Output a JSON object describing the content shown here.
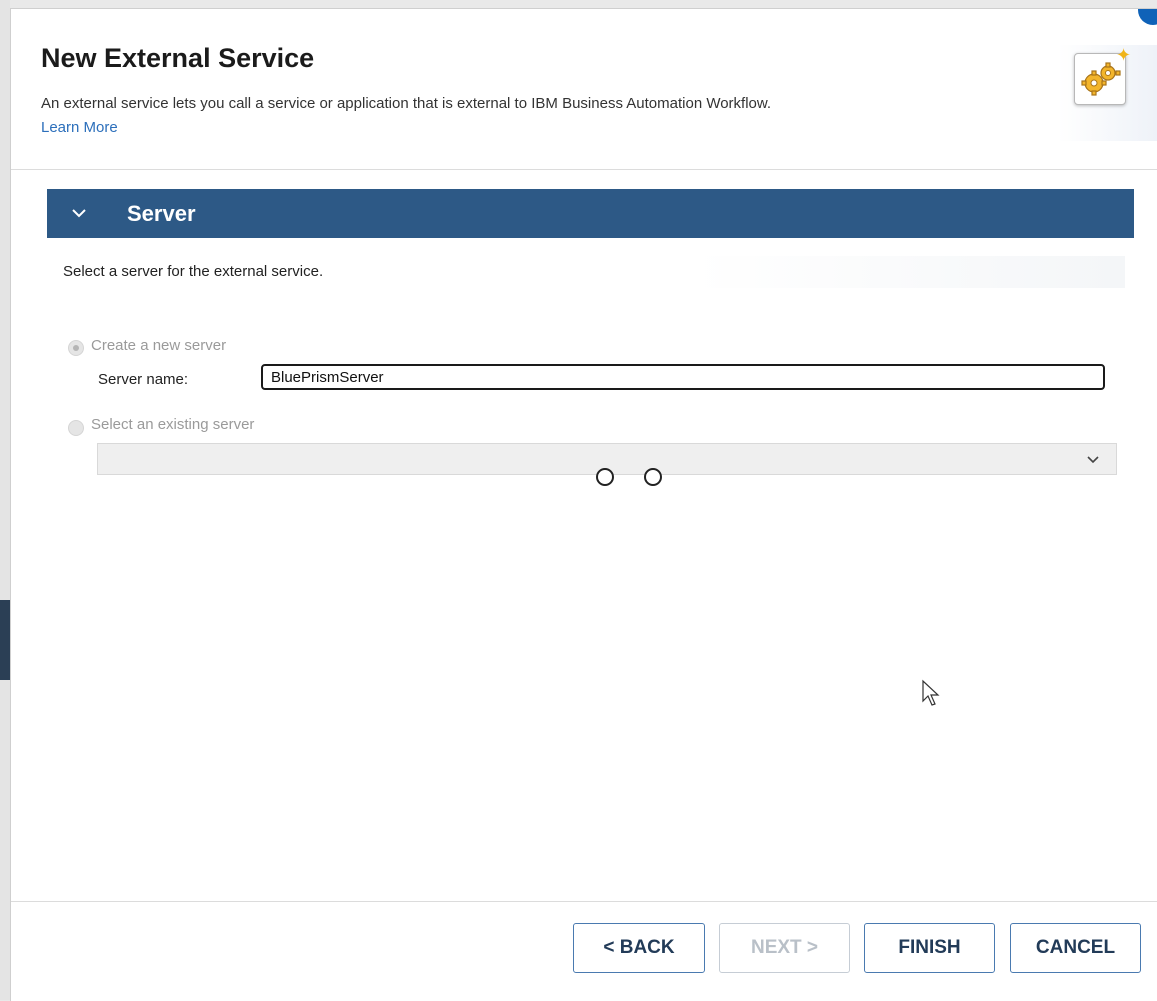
{
  "dialog": {
    "title": "New External Service",
    "description": "An external service lets you call a service or application that is external to IBM Business Automation Workflow.",
    "learn_more": "Learn More"
  },
  "section": {
    "title": "Server",
    "instruction": "Select a server for the external service."
  },
  "options": {
    "create_new_label": "Create a new server",
    "server_name_label": "Server name:",
    "server_name_value": "BluePrismServer",
    "select_existing_label": "Select an existing server",
    "existing_server_value": ""
  },
  "buttons": {
    "back": "< BACK",
    "next": "NEXT >",
    "finish": "FINISH",
    "cancel": "CANCEL"
  },
  "colors": {
    "section_header": "#2d5986",
    "accent": "#4a7ab0"
  }
}
